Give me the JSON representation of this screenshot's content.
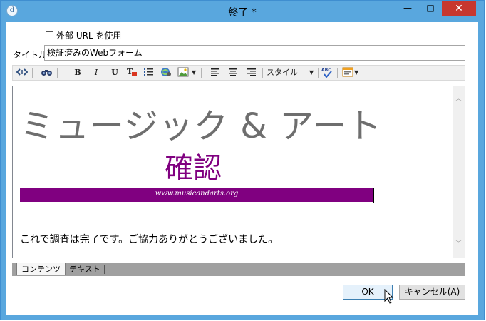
{
  "window": {
    "title": "終了 *",
    "app_icon_glyph": "d",
    "minimize_glyph": "—",
    "maximize_glyph": "□",
    "close_glyph": "✕"
  },
  "form": {
    "external_url_label": "外部 URL を使用",
    "external_url_checked": false,
    "title_label": "タイトル:",
    "title_value": "検証済みのWebフォーム"
  },
  "toolbar": {
    "items": [
      {
        "name": "source-icon",
        "glyph": "<>"
      },
      {
        "name": "find-icon",
        "glyph": "⚲"
      },
      {
        "name": "bold-button",
        "glyph": "B"
      },
      {
        "name": "italic-button",
        "glyph": "I"
      },
      {
        "name": "underline-button",
        "glyph": "U"
      },
      {
        "name": "text-color-icon",
        "glyph": "T"
      },
      {
        "name": "list-icon",
        "glyph": "☰"
      },
      {
        "name": "link-icon",
        "glyph": "🔗"
      },
      {
        "name": "image-icon",
        "glyph": "▣"
      },
      {
        "name": "align-left-icon",
        "glyph": "≡"
      },
      {
        "name": "align-center-icon",
        "glyph": "≡"
      },
      {
        "name": "align-right-icon",
        "glyph": "≡"
      },
      {
        "name": "spellcheck-icon",
        "glyph": "✓"
      },
      {
        "name": "insert-icon",
        "glyph": "▤"
      }
    ],
    "style_dropdown_label": "スタイル",
    "spell_abc": "ABC",
    "dropdown_arrow": "▼"
  },
  "editor": {
    "heading": "ミュージック & アート",
    "subheading": "確認",
    "banner_text": "www.musicandarts.org",
    "body_text": "これで調査は完了です。ご協力ありがとうございました。",
    "heading_color": "#6e6e6e",
    "accent_color": "#800080",
    "scroll_up_glyph": "︿",
    "scroll_down_glyph": "﹀"
  },
  "tabs": [
    {
      "label": "コンテンツ",
      "active": true
    },
    {
      "label": "テキスト",
      "active": false
    }
  ],
  "buttons": {
    "ok": "OK",
    "cancel": "キャンセル(A)"
  }
}
